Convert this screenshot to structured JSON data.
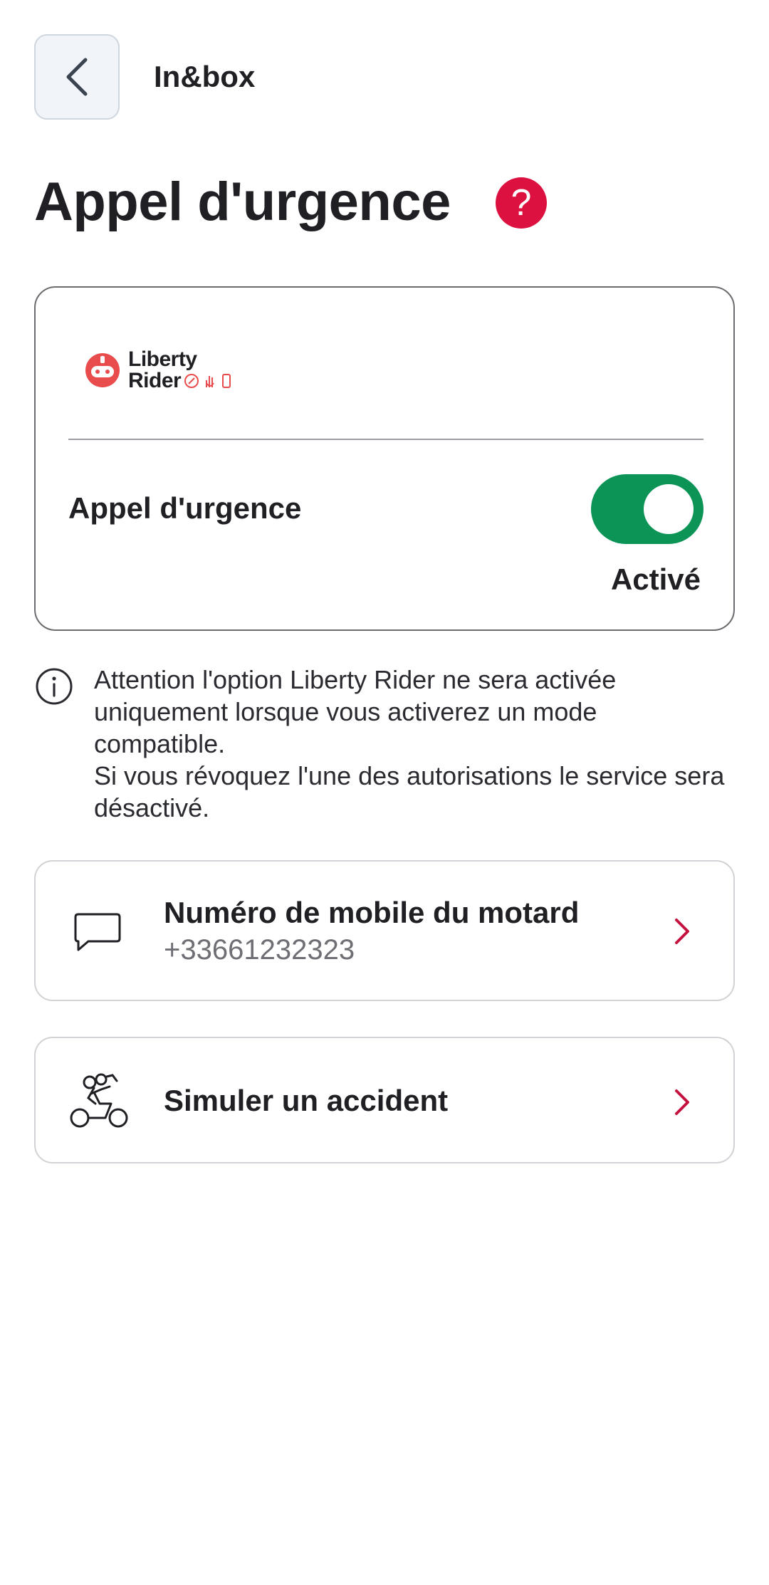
{
  "header": {
    "title": "In&box"
  },
  "page": {
    "title": "Appel d'urgence",
    "help_symbol": "?"
  },
  "card": {
    "logo": {
      "line1": "Liberty",
      "line2": "Rider"
    },
    "toggle_label": "Appel d'urgence",
    "toggle_state": "Activé",
    "toggle_on": true
  },
  "info": {
    "line1": "Attention l'option Liberty Rider ne sera activée uniquement lorsque vous activerez un mode compatible.",
    "line2": "Si vous révoquez l'une des autorisations le service sera désactivé."
  },
  "rows": [
    {
      "title": "Numéro de mobile du motard",
      "subtitle": "+33661232323",
      "icon": "chat-bubble-icon"
    },
    {
      "title": "Simuler un accident",
      "icon": "scooter-accident-icon"
    }
  ],
  "colors": {
    "accent_red": "#dd1140",
    "toggle_green": "#0c9456",
    "back_bg": "#f1f5fa"
  }
}
